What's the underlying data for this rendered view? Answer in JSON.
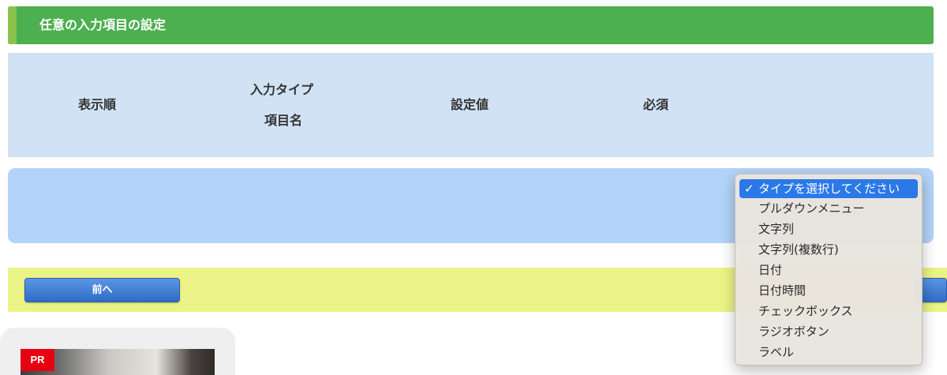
{
  "section": {
    "title": "任意の入力項目の設定"
  },
  "table_header": {
    "order": "表示順",
    "input_type": "入力タイプ",
    "item_name": "項目名",
    "setting_value": "設定値",
    "required": "必須"
  },
  "nav": {
    "prev_label": "前へ",
    "next_label": ""
  },
  "pr": {
    "badge": "PR"
  },
  "dropdown": {
    "check_glyph": "✓",
    "selected": "タイプを選択してください",
    "options": [
      "タイプを選択してください",
      "プルダウンメニュー",
      "文字列",
      "文字列(複数行)",
      "日付",
      "日付時間",
      "チェックボックス",
      "ラジオボタン",
      "ラベル"
    ]
  },
  "colors": {
    "header_green": "#4caf50",
    "header_accent": "#8bc34a",
    "table_head_bg": "#d0e2f4",
    "row_bg": "#b3d3f8",
    "nav_bg": "#ecf386",
    "button_blue": "#2f6cc4",
    "select_highlight": "#2b79e8",
    "pr_red": "#e60012"
  }
}
